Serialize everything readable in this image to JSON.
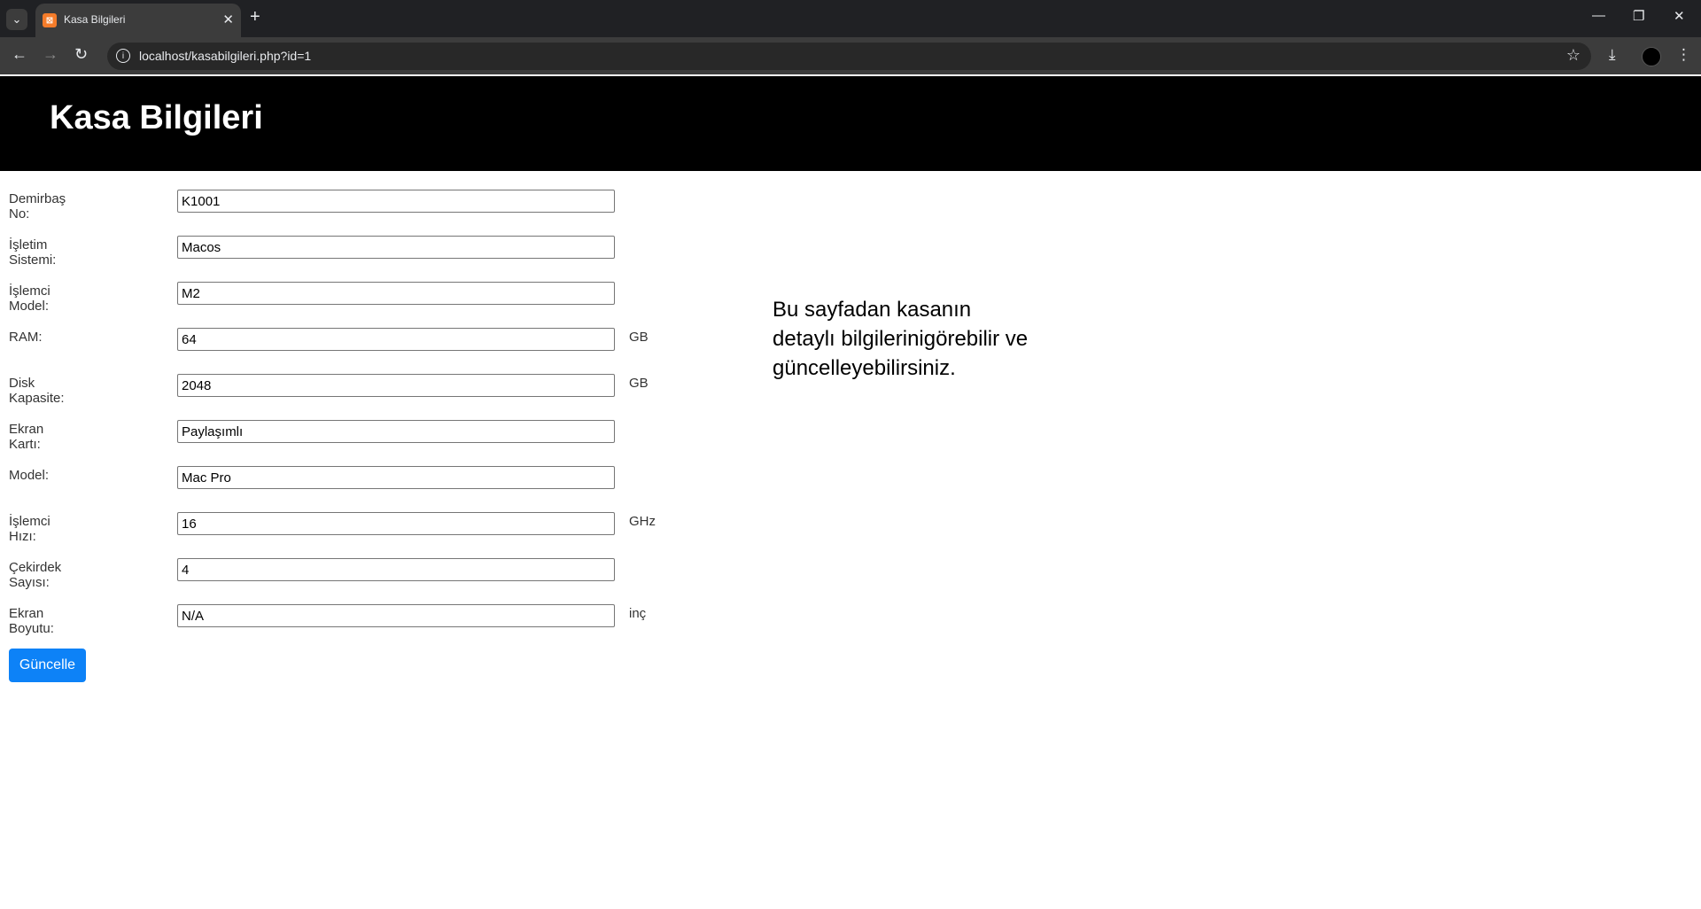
{
  "browser": {
    "tab_title": "Kasa Bilgileri",
    "favicon": "xampp-icon",
    "url": "localhost/kasabilgileri.php?id=1"
  },
  "page": {
    "title": "Kasa Bilgileri",
    "fields": [
      {
        "label": "Demirbaş No:",
        "value": "K1001",
        "unit": ""
      },
      {
        "label": "İşletim Sistemi:",
        "value": "Macos",
        "unit": ""
      },
      {
        "label": "İşlemci Model:",
        "value": "M2",
        "unit": ""
      },
      {
        "label": "RAM:",
        "value": "64",
        "unit": "GB"
      },
      {
        "label": "Disk Kapasite:",
        "value": "2048",
        "unit": "GB"
      },
      {
        "label": "Ekran Kartı:",
        "value": "Paylaşımlı",
        "unit": ""
      },
      {
        "label": "Model:",
        "value": "Mac Pro",
        "unit": ""
      },
      {
        "label": "İşlemci Hızı:",
        "value": "16",
        "unit": "GHz"
      },
      {
        "label": "Çekirdek Sayısı:",
        "value": "4",
        "unit": ""
      },
      {
        "label": "Ekran Boyutu:",
        "value": "N/A",
        "unit": "inç"
      }
    ],
    "submit_label": "Güncelle",
    "info_text": "Bu sayfadan kasanın detaylı bilgilerinigörebilir ve güncelleyebilirsiniz."
  },
  "colors": {
    "header_bg": "#000000",
    "button_bg": "#0d82f7"
  }
}
